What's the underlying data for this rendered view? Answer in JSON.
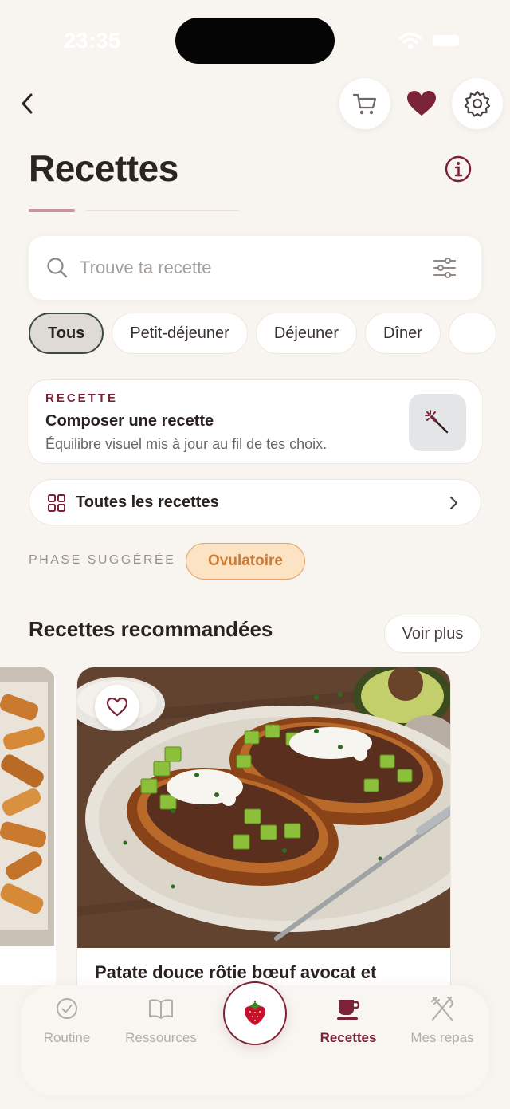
{
  "status_bar": {
    "time": "23:35"
  },
  "header": {
    "back_icon": "chevron-left-icon",
    "cart_icon": "cart-icon",
    "favorites_icon": "heart-icon",
    "settings_icon": "gear-icon",
    "title": "Recettes",
    "info_icon": "info-icon"
  },
  "search": {
    "placeholder": "Trouve ta recette",
    "value": "",
    "filter_icon": "sliders-icon"
  },
  "filters": {
    "chips": [
      {
        "label": "Tous",
        "active": true
      },
      {
        "label": "Petit-déjeuner",
        "active": false
      },
      {
        "label": "Déjeuner",
        "active": false
      },
      {
        "label": "Dîner",
        "active": false
      },
      {
        "label": "",
        "active": false
      }
    ]
  },
  "compose": {
    "eyebrow": "RECETTE",
    "title": "Composer une recette",
    "subtitle": "Équilibre visuel mis à jour au fil de tes choix.",
    "icon": "magic-wand-icon"
  },
  "all_recipes": {
    "label": "Toutes les recettes",
    "icon": "grid-icon",
    "chevron": "chevron-right-icon"
  },
  "phase": {
    "label": "PHASE SUGGÉRÉE",
    "value": "Ovulatoire"
  },
  "recommended": {
    "title": "Recettes recommandées",
    "see_more": "Voir plus",
    "cards": [
      {
        "title": "Patate douce rôtie bœuf avocat et",
        "favorite": false
      }
    ]
  },
  "tabbar": {
    "items": [
      {
        "label": "Routine",
        "icon": "check-circle-icon",
        "active": false
      },
      {
        "label": "Ressources",
        "icon": "book-icon",
        "active": false
      },
      {
        "label": "Recettes",
        "icon": "cup-icon",
        "active": true
      },
      {
        "label": "Mes repas",
        "icon": "utensils-icon",
        "active": false
      }
    ],
    "center_icon": "strawberry-icon"
  },
  "colors": {
    "accent": "#7a2336",
    "background": "#f8f5f1",
    "phase_badge_bg": "#fbe3c4",
    "phase_badge_text": "#cc7a33"
  }
}
